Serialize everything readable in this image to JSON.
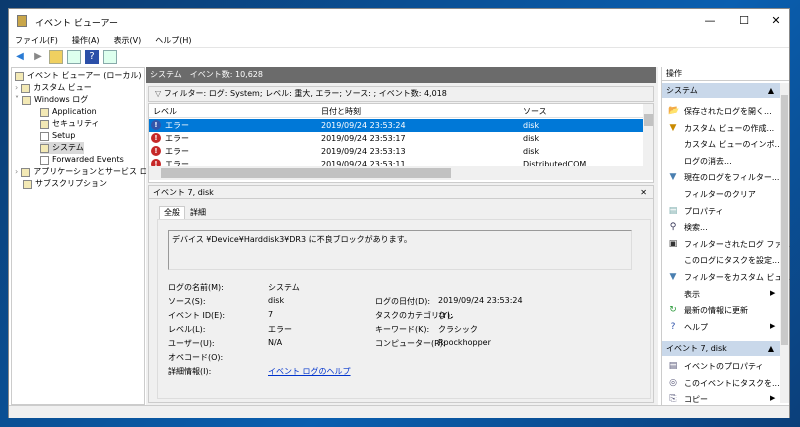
{
  "window": {
    "title": "イベント ビューアー"
  },
  "menu": [
    "ファイル(F)",
    "操作(A)",
    "表示(V)",
    "ヘルプ(H)"
  ],
  "tree": [
    {
      "label": "イベント ビューアー (ローカル)"
    },
    {
      "label": "カスタム ビュー"
    },
    {
      "label": "Windows ログ"
    },
    {
      "label": "Application"
    },
    {
      "label": "セキュリティ"
    },
    {
      "label": "Setup"
    },
    {
      "label": "システム"
    },
    {
      "label": "Forwarded Events"
    },
    {
      "label": "アプリケーションとサービス ログ"
    },
    {
      "label": "サブスクリプション"
    }
  ],
  "center": {
    "header": "システム　イベント数: 10,628",
    "filter": "フィルター: ログ: System; レベル: 重大, エラー; ソース: ; イベント数: 4,018",
    "columns": [
      "レベル",
      "日付と時刻",
      "ソース"
    ],
    "rows": [
      {
        "level": "エラー",
        "date": "2019/09/24 23:53:24",
        "source": "disk"
      },
      {
        "level": "エラー",
        "date": "2019/09/24 23:53:17",
        "source": "disk"
      },
      {
        "level": "エラー",
        "date": "2019/09/24 23:53:13",
        "source": "disk"
      },
      {
        "level": "エラー",
        "date": "2019/09/24 23:53:11",
        "source": "DistributedCOM"
      }
    ],
    "details_title": "イベント 7, disk",
    "tabs": [
      "全般",
      "詳細"
    ],
    "description": "デバイス ¥Device¥Harddisk3¥DR3 に不良ブロックがあります。",
    "fields": {
      "log_name_label": "ログの名前(M):",
      "log_name": "システム",
      "source_label": "ソース(S):",
      "source": "disk",
      "logged_label": "ログの日付(D):",
      "logged": "2019/09/24 23:53:24",
      "event_id_label": "イベント ID(E):",
      "event_id": "7",
      "task_label": "タスクのカテゴリ(Y):",
      "task": "なし",
      "level_label": "レベル(L):",
      "level": "エラー",
      "keywords_label": "キーワード(K):",
      "keywords": "クラシック",
      "user_label": "ユーザー(U):",
      "user": "N/A",
      "computer_label": "コンピューター(R):",
      "computer": "Rpockhopper",
      "opcode_label": "オペコード(O):",
      "more_info_label": "詳細情報(I):",
      "more_info_link": "イベント ログのヘルプ"
    }
  },
  "actions": {
    "title": "操作",
    "section1": "システム",
    "items1": [
      "保存されたログを開く...",
      "カスタム ビューの作成...",
      "カスタム ビューのインポ...",
      "ログの消去...",
      "現在のログをフィルター...",
      "フィルターのクリア",
      "プロパティ",
      "検索...",
      "フィルターされたログ ファ...",
      "このログにタスクを設定...",
      "フィルターをカスタム ビュ...",
      "表示",
      "最新の情報に更新",
      "ヘルプ"
    ],
    "section2": "イベント 7, disk",
    "items2": [
      "イベントのプロパティ",
      "このイベントにタスクを...",
      "コピー"
    ]
  }
}
